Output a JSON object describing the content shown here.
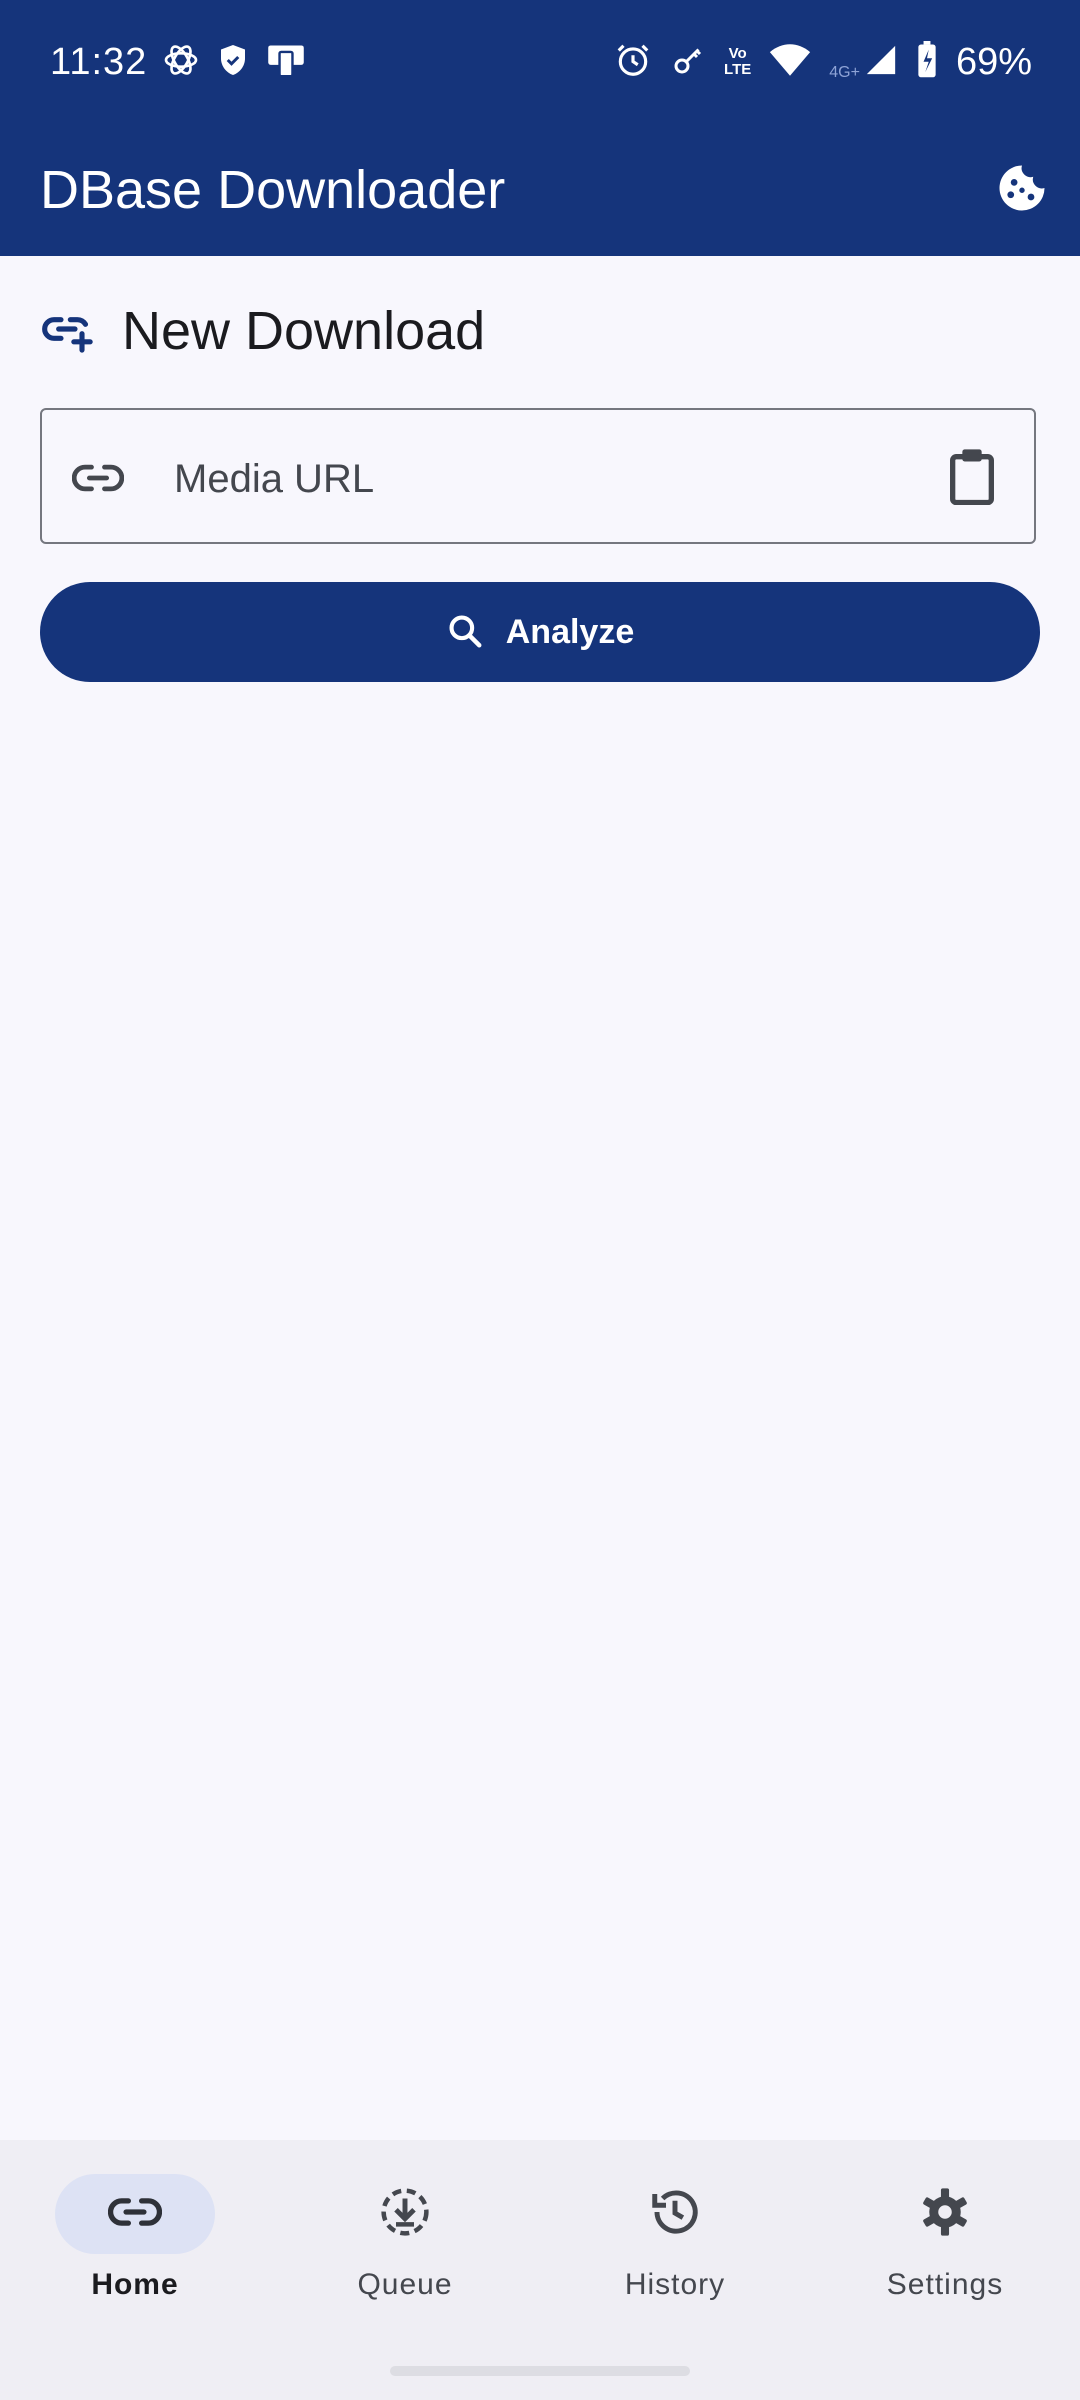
{
  "status_bar": {
    "time": "11:32",
    "lte_top": "Vo",
    "lte_bottom": "LTE",
    "network": "4G+",
    "battery": "69%"
  },
  "app_bar": {
    "title": "DBase Downloader",
    "action_icon": "cookie-icon"
  },
  "main": {
    "section_title": "New Download",
    "section_icon": "add-link-icon",
    "url_field": {
      "placeholder": "Media URL",
      "value": "",
      "leading_icon": "link-icon",
      "trailing_icon": "clipboard-icon"
    },
    "analyze_button": {
      "label": "Analyze",
      "icon": "search-icon"
    }
  },
  "bottom_nav": {
    "items": [
      {
        "label": "Home",
        "icon": "link-icon",
        "active": true
      },
      {
        "label": "Queue",
        "icon": "download-circle-icon",
        "active": false
      },
      {
        "label": "History",
        "icon": "history-icon",
        "active": false
      },
      {
        "label": "Settings",
        "icon": "gear-icon",
        "active": false
      }
    ]
  },
  "colors": {
    "primary": "#15347b",
    "background": "#f8f7fd",
    "nav_background": "#efeef4",
    "nav_indicator": "#dde2f4",
    "outline": "#75777f"
  }
}
